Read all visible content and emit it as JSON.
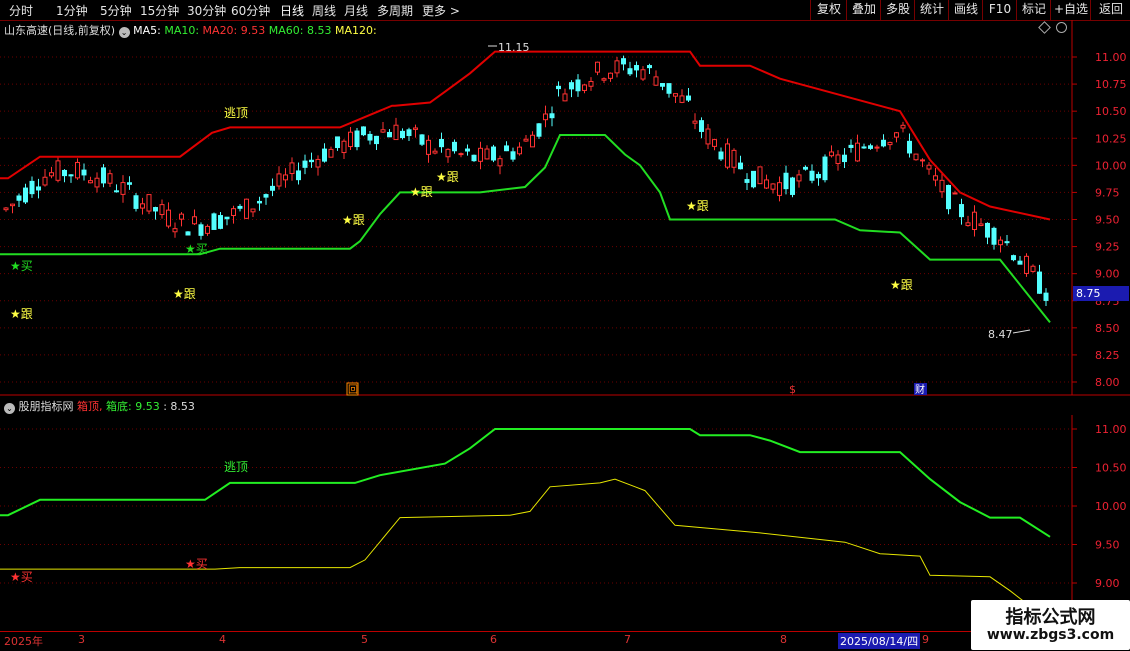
{
  "toolbar": {
    "timeframes": [
      "分时",
      "1分钟",
      "5分钟",
      "15分钟",
      "30分钟",
      "60分钟",
      "日线",
      "周线",
      "月线",
      "多周期",
      "更多 >"
    ],
    "active_timeframe": "日线",
    "right_buttons": [
      "复权",
      "叠加",
      "多股",
      "统计",
      "画线",
      "F10",
      "标记",
      "+自选",
      "返回"
    ]
  },
  "main_title": {
    "stock": "山东高速(日线,前复权)",
    "ma5": "MA5:",
    "ma10": "MA10:",
    "ma20": "MA20: 9.53",
    "ma60": "MA60: 8.53",
    "ma120": "MA120:"
  },
  "indicator_title": {
    "name": "股朋指标网",
    "top": "箱顶,",
    "bottom_label": "箱底: 9.53",
    "extra": ": 8.53"
  },
  "main_axis": [
    "11.00",
    "10.75",
    "10.50",
    "10.25",
    "10.00",
    "9.75",
    "9.50",
    "9.25",
    "9.00",
    "8.75",
    "8.50",
    "8.25",
    "8.00"
  ],
  "current_price": "8.75",
  "indicator_axis": [
    "11.00",
    "10.50",
    "10.00",
    "9.50",
    "9.00"
  ],
  "annotations": {
    "high": "11.15",
    "low": "8.47",
    "escape_top": "逃顶",
    "buy": "买",
    "follow": "跟",
    "hui": "回",
    "s": "$",
    "cai": "财"
  },
  "date_axis": {
    "labels": [
      "2025年",
      "3",
      "4",
      "5",
      "6",
      "7",
      "8",
      "2025/08/14/四",
      "9"
    ]
  },
  "watermark": {
    "line1": "指标公式网",
    "line2": "www.zbgs3.com"
  },
  "colors": {
    "up": "#ff3232",
    "down": "#54ffff",
    "box_top_main": "#e00000",
    "box_bottom_main": "#22dd22",
    "box_top_ind": "#22ee22",
    "box_bottom_ind": "#e6e600",
    "follow": "#ffff44",
    "buy": "#22dd22",
    "ma10": "#ffffff",
    "ma20": "#ff3333",
    "ma60": "#33ee33",
    "ma120": "#ffff44"
  },
  "chart_data": [
    {
      "type": "line",
      "name": "main_boxes",
      "series": [
        {
          "name": "箱顶",
          "x": [
            0,
            8,
            40,
            180,
            212,
            230,
            340,
            392,
            395,
            430,
            445,
            470,
            495,
            690,
            700,
            750,
            780,
            900,
            930,
            960,
            990,
            1050
          ],
          "values": [
            9.88,
            9.88,
            10.08,
            10.08,
            10.3,
            10.35,
            10.35,
            10.55,
            10.55,
            10.58,
            10.68,
            10.85,
            11.05,
            11.05,
            10.92,
            10.92,
            10.8,
            10.5,
            10.05,
            9.75,
            9.62,
            9.5
          ]
        },
        {
          "name": "箱底",
          "x": [
            0,
            200,
            220,
            350,
            360,
            380,
            400,
            480,
            525,
            545,
            560,
            605,
            625,
            640,
            660,
            670,
            770,
            835,
            860,
            900,
            930,
            1000,
            1050
          ],
          "values": [
            9.18,
            9.18,
            9.23,
            9.23,
            9.3,
            9.55,
            9.75,
            9.75,
            9.8,
            9.98,
            10.28,
            10.28,
            10.1,
            10.0,
            9.75,
            9.5,
            9.5,
            9.5,
            9.4,
            9.38,
            9.13,
            9.13,
            8.55
          ]
        }
      ]
    },
    {
      "type": "line",
      "name": "indicator",
      "series": [
        {
          "name": "箱顶",
          "x": [
            0,
            8,
            40,
            205,
            230,
            355,
            380,
            445,
            470,
            495,
            690,
            700,
            750,
            770,
            800,
            900,
            930,
            960,
            990,
            1020,
            1050
          ],
          "values": [
            9.88,
            9.88,
            10.08,
            10.08,
            10.3,
            10.3,
            10.4,
            10.55,
            10.75,
            11.0,
            11.0,
            10.92,
            10.92,
            10.85,
            10.7,
            10.7,
            10.35,
            10.05,
            9.85,
            9.85,
            9.6
          ]
        },
        {
          "name": "箱底",
          "x": [
            0,
            215,
            240,
            350,
            365,
            400,
            510,
            530,
            550,
            600,
            615,
            645,
            675,
            760,
            845,
            880,
            920,
            930,
            990,
            1010,
            1050
          ],
          "values": [
            9.18,
            9.18,
            9.2,
            9.2,
            9.3,
            9.85,
            9.88,
            9.93,
            10.25,
            10.3,
            10.35,
            10.2,
            9.75,
            9.65,
            9.53,
            9.38,
            9.35,
            9.1,
            9.08,
            8.9,
            8.5
          ]
        }
      ]
    }
  ]
}
